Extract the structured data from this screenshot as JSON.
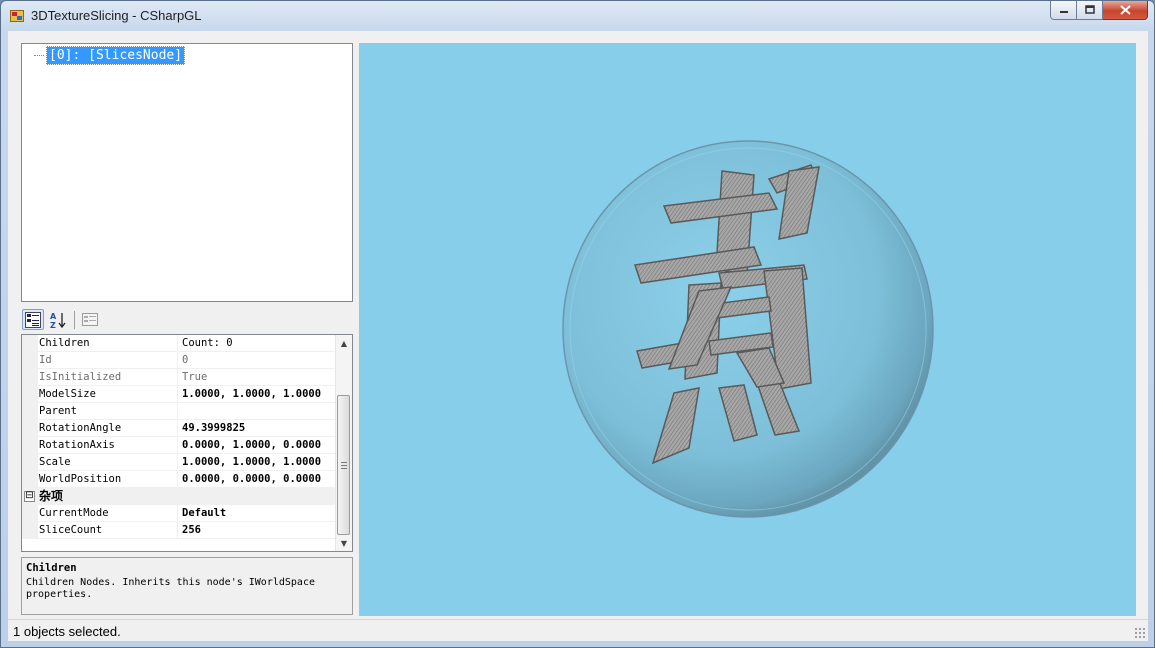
{
  "window": {
    "title": "3DTextureSlicing - CSharpGL",
    "controls": {
      "minimize": "minimize-icon",
      "maximize": "maximize-icon",
      "close": "close-icon"
    }
  },
  "tree": {
    "selected_node": "[0]: [SlicesNode]"
  },
  "property_grid": {
    "toolbar": [
      "categorized-icon",
      "alphabetical-icon",
      "property-pages-icon"
    ],
    "rows": [
      {
        "name": "Children",
        "value": "Count: 0",
        "readonly": false,
        "bold": false
      },
      {
        "name": "Id",
        "value": "0",
        "readonly": true,
        "bold": false
      },
      {
        "name": "IsInitialized",
        "value": "True",
        "readonly": true,
        "bold": false
      },
      {
        "name": "ModelSize",
        "value": "1.0000, 1.0000, 1.0000",
        "readonly": false,
        "bold": true
      },
      {
        "name": "Parent",
        "value": "",
        "readonly": false,
        "bold": false
      },
      {
        "name": "RotationAngle",
        "value": "49.3999825",
        "readonly": false,
        "bold": true
      },
      {
        "name": "RotationAxis",
        "value": "0.0000, 1.0000, 0.0000",
        "readonly": false,
        "bold": true
      },
      {
        "name": "Scale",
        "value": "1.0000, 1.0000, 1.0000",
        "readonly": false,
        "bold": true
      },
      {
        "name": "WorldPosition",
        "value": "0.0000, 0.0000, 0.0000",
        "readonly": false,
        "bold": true
      }
    ],
    "category": {
      "toggle": "⊟",
      "label": "杂项"
    },
    "category_rows": [
      {
        "name": "CurrentMode",
        "value": "Default",
        "readonly": false,
        "bold": true
      },
      {
        "name": "SliceCount",
        "value": "256",
        "readonly": false,
        "bold": true
      }
    ],
    "description": {
      "title": "Children",
      "text": "Children Nodes. Inherits this node's IWorldSpace properties."
    }
  },
  "viewport": {
    "background": "#87ceeb",
    "glyph": "煮"
  },
  "status": {
    "text": "1 objects selected."
  }
}
